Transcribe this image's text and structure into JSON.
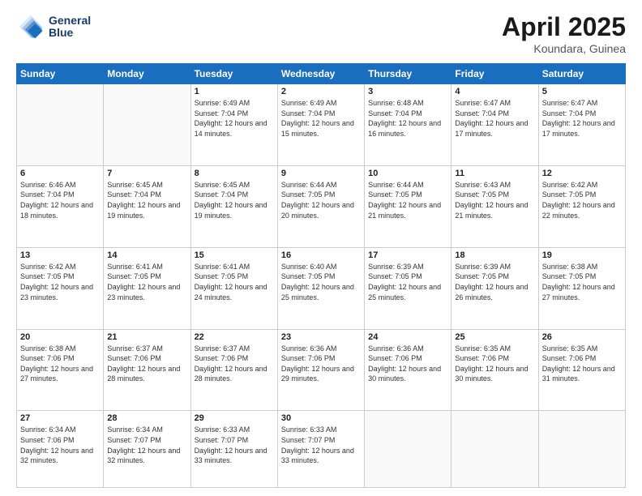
{
  "header": {
    "logo_line1": "General",
    "logo_line2": "Blue",
    "month_year": "April 2025",
    "location": "Koundara, Guinea"
  },
  "weekdays": [
    "Sunday",
    "Monday",
    "Tuesday",
    "Wednesday",
    "Thursday",
    "Friday",
    "Saturday"
  ],
  "weeks": [
    [
      {
        "day": "",
        "text": ""
      },
      {
        "day": "",
        "text": ""
      },
      {
        "day": "1",
        "text": "Sunrise: 6:49 AM\nSunset: 7:04 PM\nDaylight: 12 hours and 14 minutes."
      },
      {
        "day": "2",
        "text": "Sunrise: 6:49 AM\nSunset: 7:04 PM\nDaylight: 12 hours and 15 minutes."
      },
      {
        "day": "3",
        "text": "Sunrise: 6:48 AM\nSunset: 7:04 PM\nDaylight: 12 hours and 16 minutes."
      },
      {
        "day": "4",
        "text": "Sunrise: 6:47 AM\nSunset: 7:04 PM\nDaylight: 12 hours and 17 minutes."
      },
      {
        "day": "5",
        "text": "Sunrise: 6:47 AM\nSunset: 7:04 PM\nDaylight: 12 hours and 17 minutes."
      }
    ],
    [
      {
        "day": "6",
        "text": "Sunrise: 6:46 AM\nSunset: 7:04 PM\nDaylight: 12 hours and 18 minutes."
      },
      {
        "day": "7",
        "text": "Sunrise: 6:45 AM\nSunset: 7:04 PM\nDaylight: 12 hours and 19 minutes."
      },
      {
        "day": "8",
        "text": "Sunrise: 6:45 AM\nSunset: 7:04 PM\nDaylight: 12 hours and 19 minutes."
      },
      {
        "day": "9",
        "text": "Sunrise: 6:44 AM\nSunset: 7:05 PM\nDaylight: 12 hours and 20 minutes."
      },
      {
        "day": "10",
        "text": "Sunrise: 6:44 AM\nSunset: 7:05 PM\nDaylight: 12 hours and 21 minutes."
      },
      {
        "day": "11",
        "text": "Sunrise: 6:43 AM\nSunset: 7:05 PM\nDaylight: 12 hours and 21 minutes."
      },
      {
        "day": "12",
        "text": "Sunrise: 6:42 AM\nSunset: 7:05 PM\nDaylight: 12 hours and 22 minutes."
      }
    ],
    [
      {
        "day": "13",
        "text": "Sunrise: 6:42 AM\nSunset: 7:05 PM\nDaylight: 12 hours and 23 minutes."
      },
      {
        "day": "14",
        "text": "Sunrise: 6:41 AM\nSunset: 7:05 PM\nDaylight: 12 hours and 23 minutes."
      },
      {
        "day": "15",
        "text": "Sunrise: 6:41 AM\nSunset: 7:05 PM\nDaylight: 12 hours and 24 minutes."
      },
      {
        "day": "16",
        "text": "Sunrise: 6:40 AM\nSunset: 7:05 PM\nDaylight: 12 hours and 25 minutes."
      },
      {
        "day": "17",
        "text": "Sunrise: 6:39 AM\nSunset: 7:05 PM\nDaylight: 12 hours and 25 minutes."
      },
      {
        "day": "18",
        "text": "Sunrise: 6:39 AM\nSunset: 7:05 PM\nDaylight: 12 hours and 26 minutes."
      },
      {
        "day": "19",
        "text": "Sunrise: 6:38 AM\nSunset: 7:05 PM\nDaylight: 12 hours and 27 minutes."
      }
    ],
    [
      {
        "day": "20",
        "text": "Sunrise: 6:38 AM\nSunset: 7:06 PM\nDaylight: 12 hours and 27 minutes."
      },
      {
        "day": "21",
        "text": "Sunrise: 6:37 AM\nSunset: 7:06 PM\nDaylight: 12 hours and 28 minutes."
      },
      {
        "day": "22",
        "text": "Sunrise: 6:37 AM\nSunset: 7:06 PM\nDaylight: 12 hours and 28 minutes."
      },
      {
        "day": "23",
        "text": "Sunrise: 6:36 AM\nSunset: 7:06 PM\nDaylight: 12 hours and 29 minutes."
      },
      {
        "day": "24",
        "text": "Sunrise: 6:36 AM\nSunset: 7:06 PM\nDaylight: 12 hours and 30 minutes."
      },
      {
        "day": "25",
        "text": "Sunrise: 6:35 AM\nSunset: 7:06 PM\nDaylight: 12 hours and 30 minutes."
      },
      {
        "day": "26",
        "text": "Sunrise: 6:35 AM\nSunset: 7:06 PM\nDaylight: 12 hours and 31 minutes."
      }
    ],
    [
      {
        "day": "27",
        "text": "Sunrise: 6:34 AM\nSunset: 7:06 PM\nDaylight: 12 hours and 32 minutes."
      },
      {
        "day": "28",
        "text": "Sunrise: 6:34 AM\nSunset: 7:07 PM\nDaylight: 12 hours and 32 minutes."
      },
      {
        "day": "29",
        "text": "Sunrise: 6:33 AM\nSunset: 7:07 PM\nDaylight: 12 hours and 33 minutes."
      },
      {
        "day": "30",
        "text": "Sunrise: 6:33 AM\nSunset: 7:07 PM\nDaylight: 12 hours and 33 minutes."
      },
      {
        "day": "",
        "text": ""
      },
      {
        "day": "",
        "text": ""
      },
      {
        "day": "",
        "text": ""
      }
    ]
  ]
}
